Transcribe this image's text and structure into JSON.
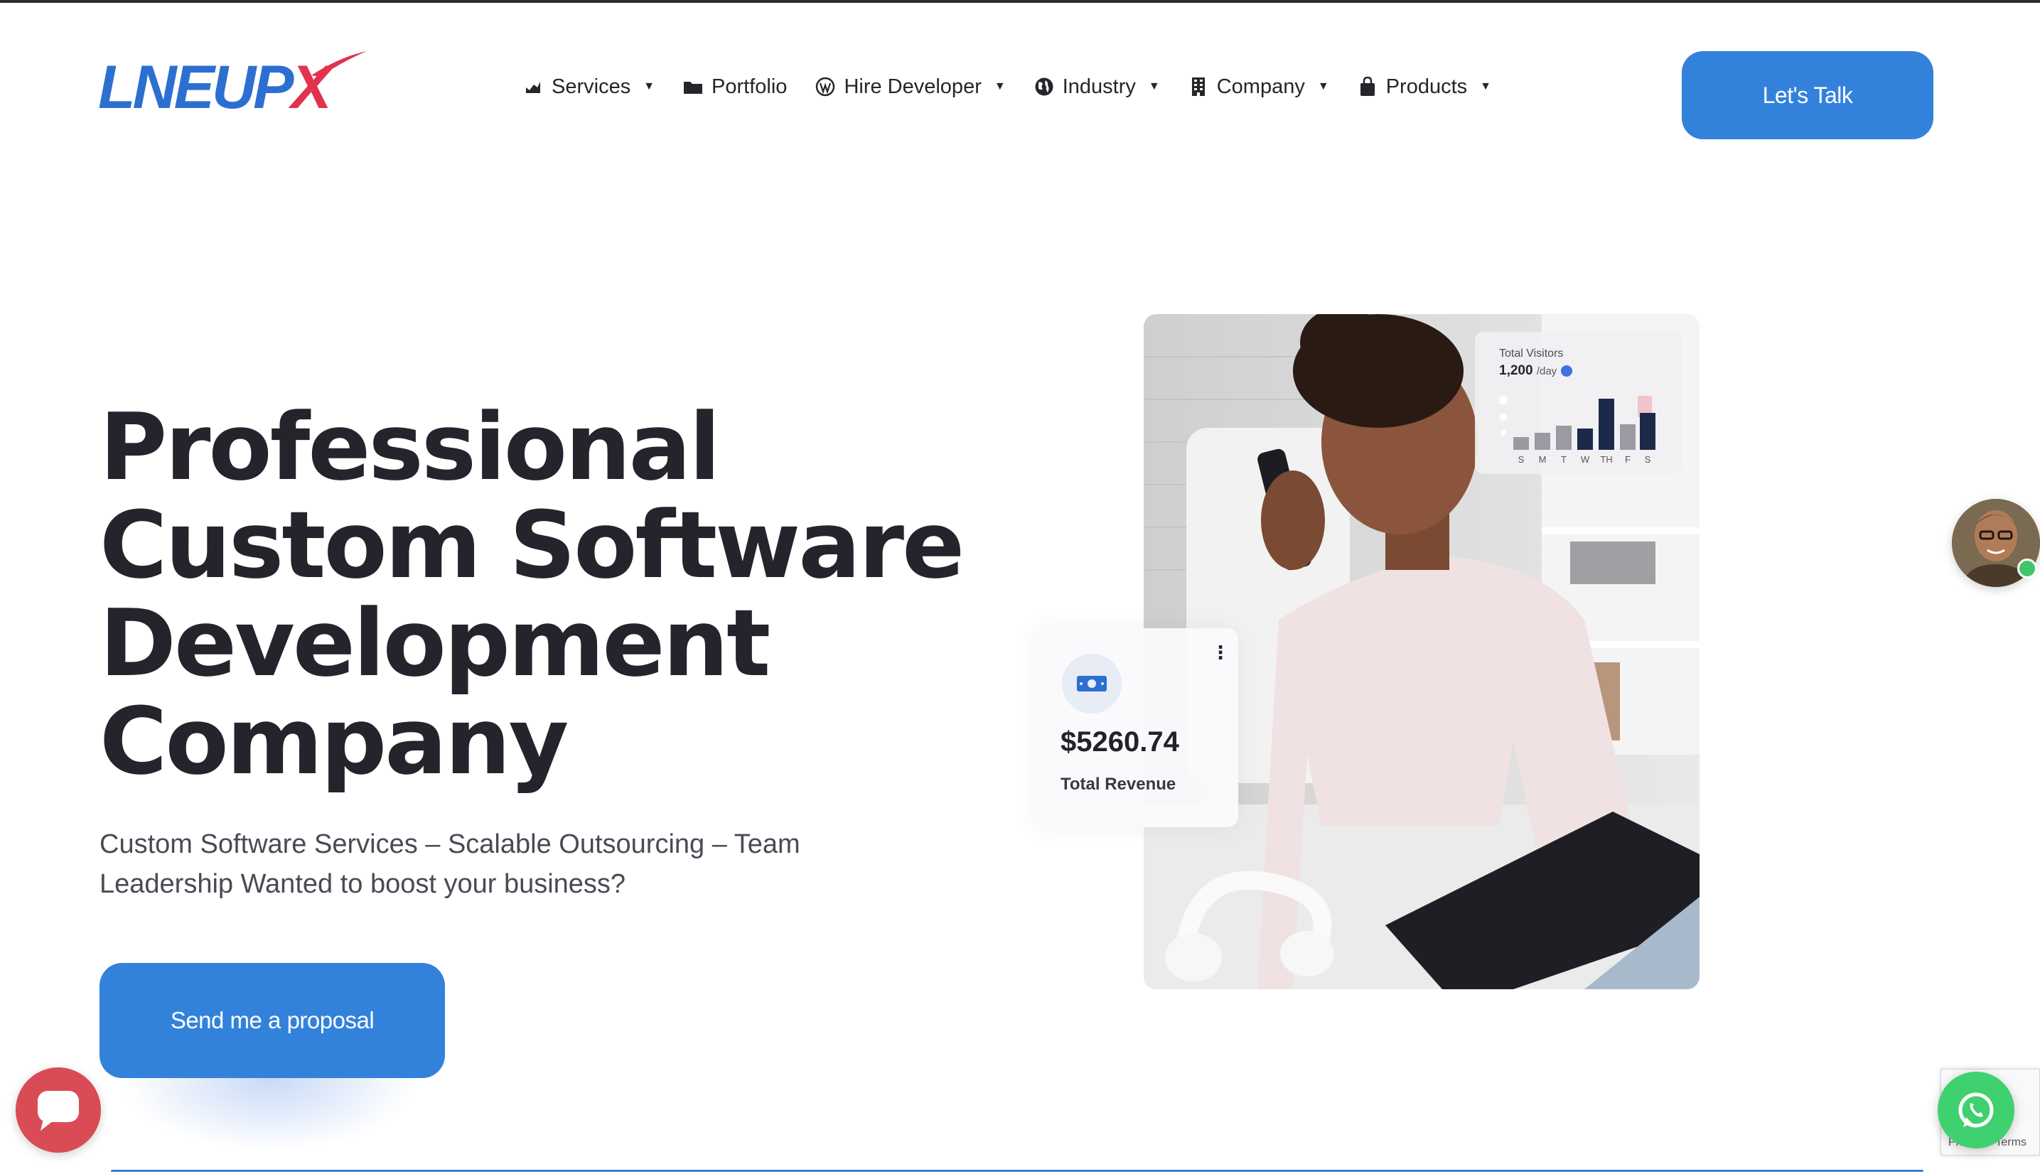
{
  "brand": {
    "logo_text_main": "LNEUP",
    "logo_text_accent": "X",
    "primary_color": "#3282db",
    "accent_color": "#e2324e"
  },
  "nav": {
    "items": [
      {
        "label": "Services",
        "icon": "chart-icon",
        "has_dropdown": true
      },
      {
        "label": "Portfolio",
        "icon": "folder-icon",
        "has_dropdown": false
      },
      {
        "label": "Hire Developer",
        "icon": "wordpress-icon",
        "has_dropdown": true
      },
      {
        "label": "Industry",
        "icon": "globe-icon",
        "has_dropdown": true
      },
      {
        "label": "Company",
        "icon": "building-icon",
        "has_dropdown": true
      },
      {
        "label": "Products",
        "icon": "shopping-bag-icon",
        "has_dropdown": true
      }
    ],
    "cta_label": "Let's Talk"
  },
  "hero": {
    "title_lines": [
      "Professional",
      "Custom Software",
      "Development",
      "Company"
    ],
    "subtitle": "Custom Software Services – Scalable Outsourcing – Team Leadership Wanted to boost your business?",
    "cta_label": "Send me a proposal"
  },
  "visitors_card": {
    "label": "Total Visitors",
    "value": "1,200",
    "unit": "/day",
    "days": [
      "S",
      "M",
      "T",
      "W",
      "TH",
      "F",
      "S"
    ]
  },
  "revenue_card": {
    "value": "$5260.74",
    "label": "Total Revenue",
    "menu_glyph": "⋮"
  },
  "widgets": {
    "recaptcha_text": "Privacy - Terms"
  }
}
